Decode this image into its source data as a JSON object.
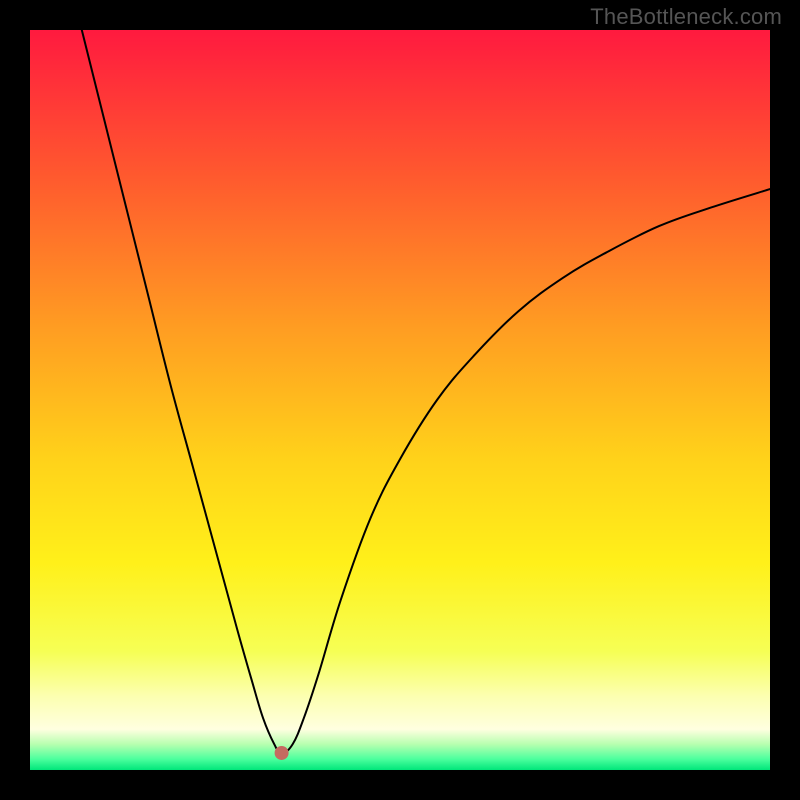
{
  "watermark": "TheBottleneck.com",
  "chart_data": {
    "type": "line",
    "title": "",
    "xlabel": "",
    "ylabel": "",
    "xlim": [
      0,
      100
    ],
    "ylim": [
      0,
      100
    ],
    "grid": false,
    "legend": false,
    "background_gradient": {
      "stops": [
        {
          "offset": 0.0,
          "color": "#ff1a3f"
        },
        {
          "offset": 0.2,
          "color": "#ff5a2e"
        },
        {
          "offset": 0.4,
          "color": "#ff9c22"
        },
        {
          "offset": 0.58,
          "color": "#ffd21a"
        },
        {
          "offset": 0.72,
          "color": "#fff01a"
        },
        {
          "offset": 0.84,
          "color": "#f6ff55"
        },
        {
          "offset": 0.9,
          "color": "#fcffb0"
        },
        {
          "offset": 0.945,
          "color": "#ffffe0"
        },
        {
          "offset": 0.965,
          "color": "#b8ffb0"
        },
        {
          "offset": 0.985,
          "color": "#4dff9e"
        },
        {
          "offset": 1.0,
          "color": "#00e67a"
        }
      ]
    },
    "marker": {
      "x": 34.0,
      "y": 2.3,
      "color": "#c56a60",
      "radius_px": 7
    },
    "series": [
      {
        "name": "bottleneck-curve",
        "color": "#000000",
        "stroke_width_px": 2.0,
        "x": [
          7.0,
          10.0,
          13.0,
          16.0,
          19.0,
          22.0,
          25.0,
          28.0,
          30.0,
          31.5,
          33.0,
          34.0,
          35.5,
          37.0,
          39.0,
          42.0,
          46.0,
          50.0,
          55.0,
          60.0,
          66.0,
          72.0,
          78.0,
          85.0,
          92.0,
          100.0
        ],
        "y": [
          100.0,
          88.0,
          76.0,
          64.0,
          52.0,
          41.0,
          30.0,
          19.0,
          12.0,
          7.0,
          3.5,
          2.2,
          3.5,
          7.0,
          13.0,
          23.0,
          34.0,
          42.0,
          50.0,
          56.0,
          62.0,
          66.5,
          70.0,
          73.5,
          76.0,
          78.5
        ]
      }
    ]
  }
}
